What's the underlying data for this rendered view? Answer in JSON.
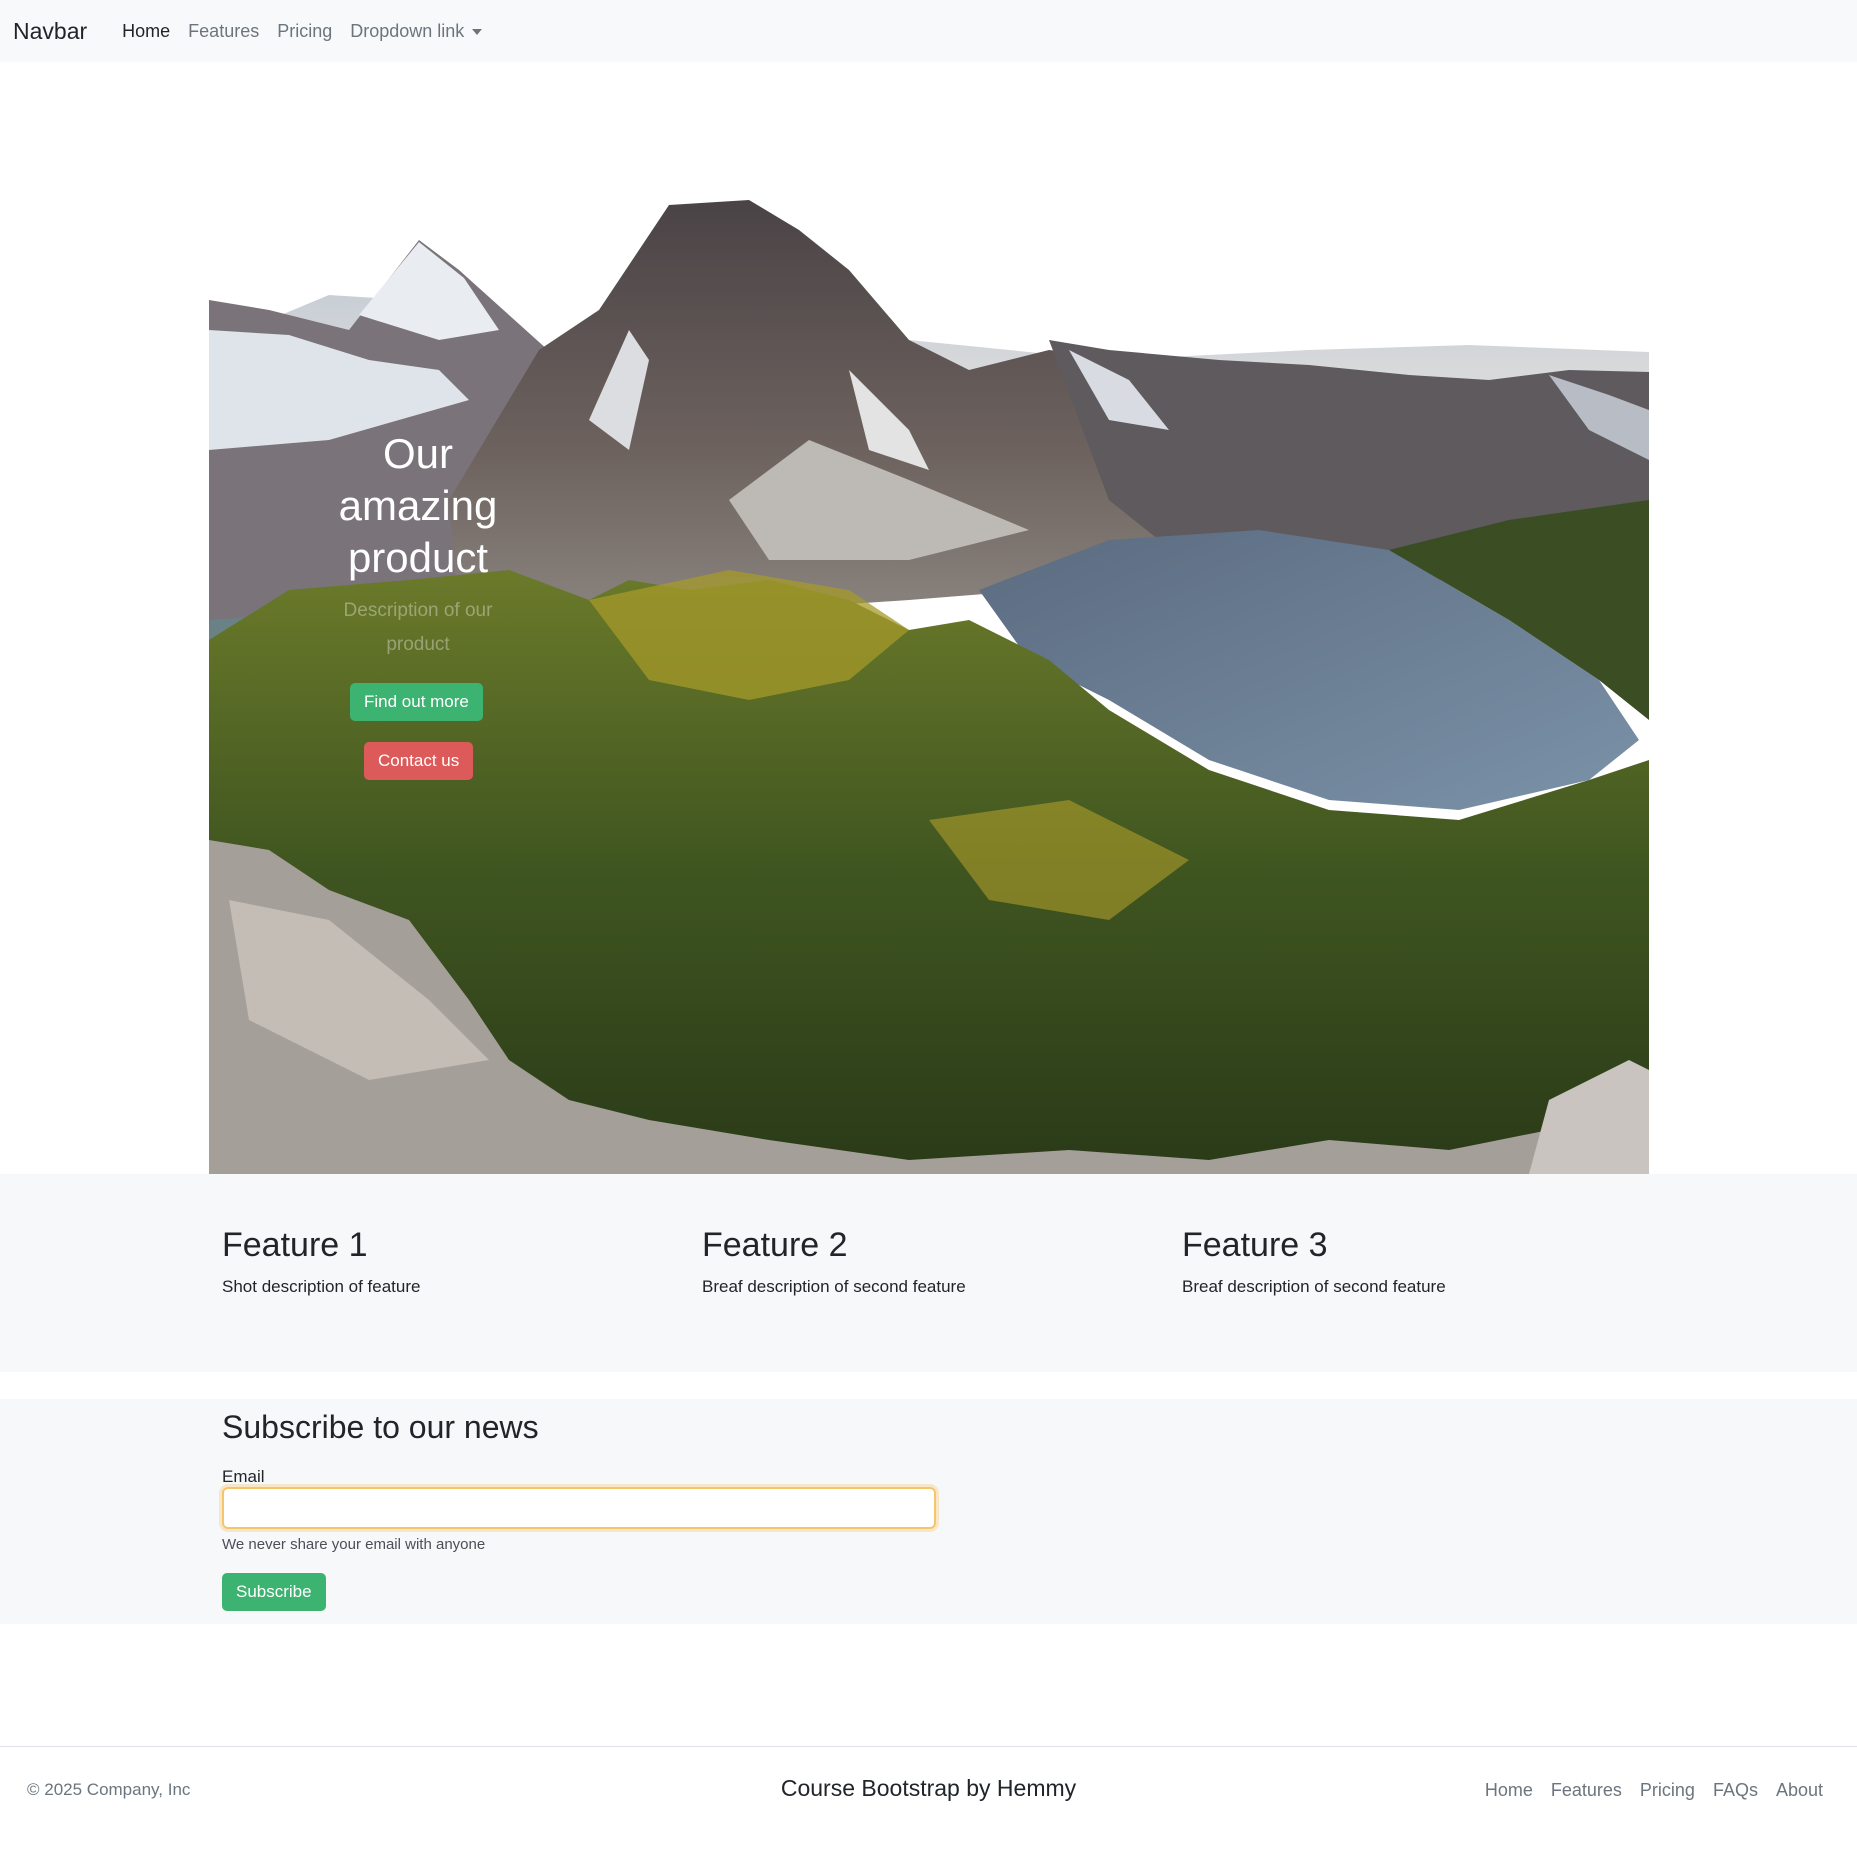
{
  "navbar": {
    "brand": "Navbar",
    "links": [
      {
        "label": "Home",
        "active": true
      },
      {
        "label": "Features",
        "active": false
      },
      {
        "label": "Pricing",
        "active": false
      },
      {
        "label": "Dropdown link",
        "active": false
      }
    ]
  },
  "hero": {
    "title": "Our amazing product",
    "description": "Description of our product",
    "primary_button": "Find out more",
    "secondary_button": "Contact us"
  },
  "features": [
    {
      "title": "Feature 1",
      "description": "Shot description of feature"
    },
    {
      "title": "Feature 2",
      "description": "Breaf description of second feature"
    },
    {
      "title": "Feature 3",
      "description": "Breaf description of second feature"
    }
  ],
  "subscribe": {
    "title": "Subscribe to our news",
    "email_label": "Email",
    "email_value": "",
    "help_text": "We never share your email with anyone",
    "button": "Subscribe"
  },
  "footer": {
    "copyright": "© 2025 Company, Inc",
    "center": "Course Bootstrap by Hemmy",
    "links": [
      "Home",
      "Features",
      "Pricing",
      "FAQs",
      "About"
    ]
  },
  "colors": {
    "primary_green": "#3cb371",
    "danger_red": "#dc5a5a",
    "focus_ring": "#f5c56b",
    "light_bg": "#f7f8fa"
  }
}
